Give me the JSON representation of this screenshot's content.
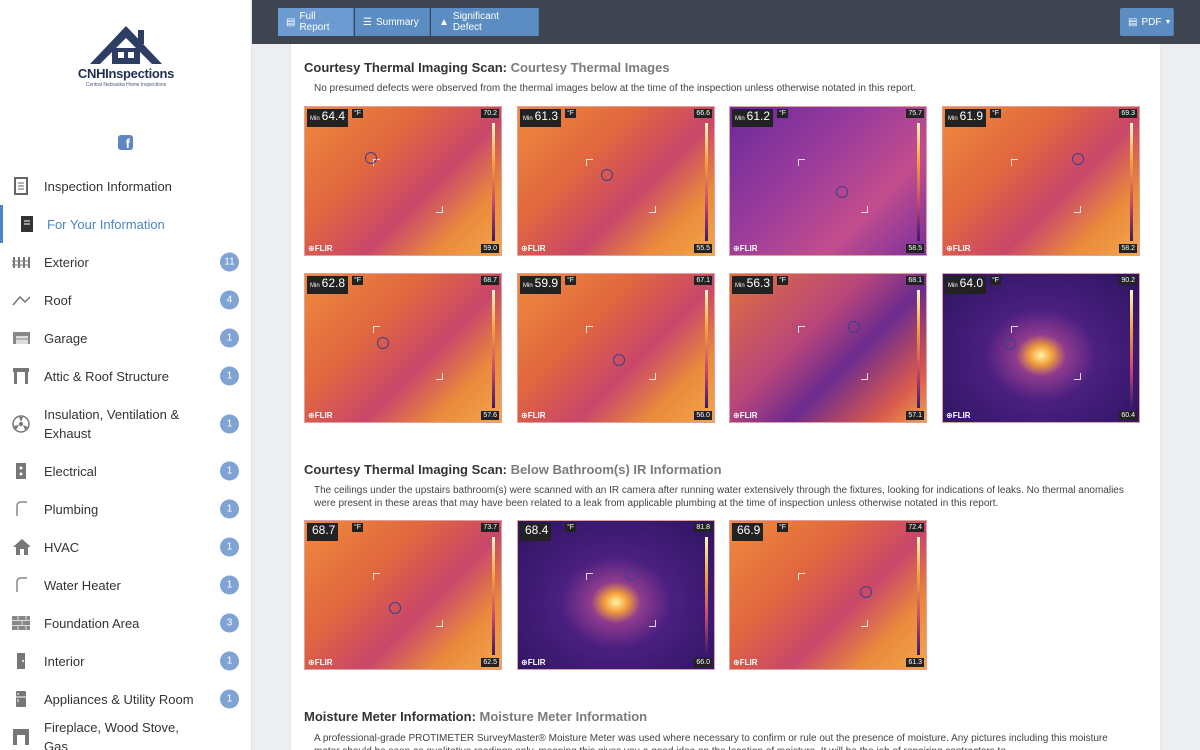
{
  "logo": {
    "name": "CNHInspections",
    "tagline": "Central Nebraska Home Inspections"
  },
  "sidebar": {
    "items": [
      {
        "label": "Inspection Information",
        "icon": "report-icon",
        "active": false,
        "badge": ""
      },
      {
        "label": "For Your Information",
        "icon": "info-doc-icon",
        "active": true,
        "badge": ""
      },
      {
        "label": "Exterior",
        "icon": "fence-icon",
        "active": false,
        "badge": "11"
      },
      {
        "label": "Roof",
        "icon": "roof-icon",
        "active": false,
        "badge": "4"
      },
      {
        "label": "Garage",
        "icon": "garage-icon",
        "active": false,
        "badge": "1"
      },
      {
        "label": "Attic & Roof Structure",
        "icon": "attic-icon",
        "active": false,
        "badge": "1"
      },
      {
        "label": "Insulation, Ventilation & Exhaust",
        "icon": "fan-icon",
        "active": false,
        "badge": "1"
      },
      {
        "label": "Electrical",
        "icon": "electrical-panel-icon",
        "active": false,
        "badge": "1"
      },
      {
        "label": "Plumbing",
        "icon": "pipe-icon",
        "active": false,
        "badge": "1"
      },
      {
        "label": "HVAC",
        "icon": "house-hvac-icon",
        "active": false,
        "badge": "1"
      },
      {
        "label": "Water Heater",
        "icon": "pipe-icon",
        "active": false,
        "badge": "1"
      },
      {
        "label": "Foundation Area",
        "icon": "brick-icon",
        "active": false,
        "badge": "3"
      },
      {
        "label": "Interior",
        "icon": "door-icon",
        "active": false,
        "badge": "1"
      },
      {
        "label": "Appliances & Utility Room",
        "icon": "fridge-icon",
        "active": false,
        "badge": "1"
      },
      {
        "label": "Fireplace, Wood Stove, Gas",
        "icon": "fireplace-icon",
        "active": false,
        "badge": ""
      }
    ]
  },
  "toolbar": {
    "full_report": "Full Report",
    "summary": "Summary",
    "significant_defect": "Significant Defect",
    "pdf": "PDF"
  },
  "sections": [
    {
      "title": "Courtesy Thermal Imaging Scan:",
      "subtitle": "Courtesy Thermal Images",
      "description": "No presumed defects were observed from the thermal images below at the time of the inspection unless otherwise notated in this report."
    },
    {
      "title": "Courtesy Thermal Imaging Scan:",
      "subtitle": "Below Bathroom(s) IR Information",
      "description": "The ceilings under the upstairs bathroom(s) were scanned with an IR camera after running water extensively through the fixtures, looking for indications of leaks. No thermal anomalies were present in these areas that may have been related to a leak from applicable plumbing at the time of inspection unless otherwise notated in this report."
    },
    {
      "title": "Moisture Meter Information:",
      "subtitle": "Moisture Meter Information",
      "description": "A professional-grade PROTIMETER SurveyMaster® Moisture Meter was used where necessary to confirm or rule out the presence of moisture. Any pictures including this moisture meter should be seen as qualitative readings only, meaning this gives you a good idea on the location of moisture. It will be the job of repairing contractors to"
    }
  ],
  "thermal_images": [
    {
      "min_label": "Min",
      "min": "64.4",
      "unit": "°F",
      "max_scale": "70.2",
      "min_scale": "59.0",
      "brand": "FLIR",
      "palette": "orange"
    },
    {
      "min_label": "Min",
      "min": "61.3",
      "unit": "°F",
      "max_scale": "66.6",
      "min_scale": "55.5",
      "brand": "FLIR",
      "palette": "orange"
    },
    {
      "min_label": "Min",
      "min": "61.2",
      "unit": "°F",
      "max_scale": "75.7",
      "min_scale": "58.5",
      "brand": "FLIR",
      "palette": "purple"
    },
    {
      "min_label": "Min",
      "min": "61.9",
      "unit": "°F",
      "max_scale": "69.3",
      "min_scale": "58.2",
      "brand": "FLIR",
      "palette": "orange"
    },
    {
      "min_label": "Min",
      "min": "62.8",
      "unit": "°F",
      "max_scale": "68.7",
      "min_scale": "57.6",
      "brand": "FLIR",
      "palette": "orange"
    },
    {
      "min_label": "Min",
      "min": "59.9",
      "unit": "°F",
      "max_scale": "67.1",
      "min_scale": "56.0",
      "brand": "FLIR",
      "palette": "orange"
    },
    {
      "min_label": "Min",
      "min": "56.3",
      "unit": "°F",
      "max_scale": "68.1",
      "min_scale": "57.1",
      "brand": "FLIR",
      "palette": "mixed"
    },
    {
      "min_label": "Min",
      "min": "64.0",
      "unit": "°F",
      "max_scale": "90.2",
      "min_scale": "60.4",
      "brand": "FLIR",
      "palette": "dark"
    },
    {
      "min_label": "",
      "min": "68.7",
      "unit": "°F",
      "max_scale": "73.7",
      "min_scale": "62.5",
      "brand": "FLIR",
      "palette": "orange"
    },
    {
      "min_label": "",
      "min": "68.4",
      "unit": "°F",
      "max_scale": "81.8",
      "min_scale": "66.0",
      "brand": "FLIR",
      "palette": "dark"
    },
    {
      "min_label": "",
      "min": "66.9",
      "unit": "°F",
      "max_scale": "72.4",
      "min_scale": "61.3",
      "brand": "FLIR",
      "palette": "orange"
    }
  ],
  "colors": {
    "accent": "#4a86c5",
    "topbar": "#3e4551",
    "button": "#5b8dc3",
    "badge": "#7fa3d3"
  }
}
